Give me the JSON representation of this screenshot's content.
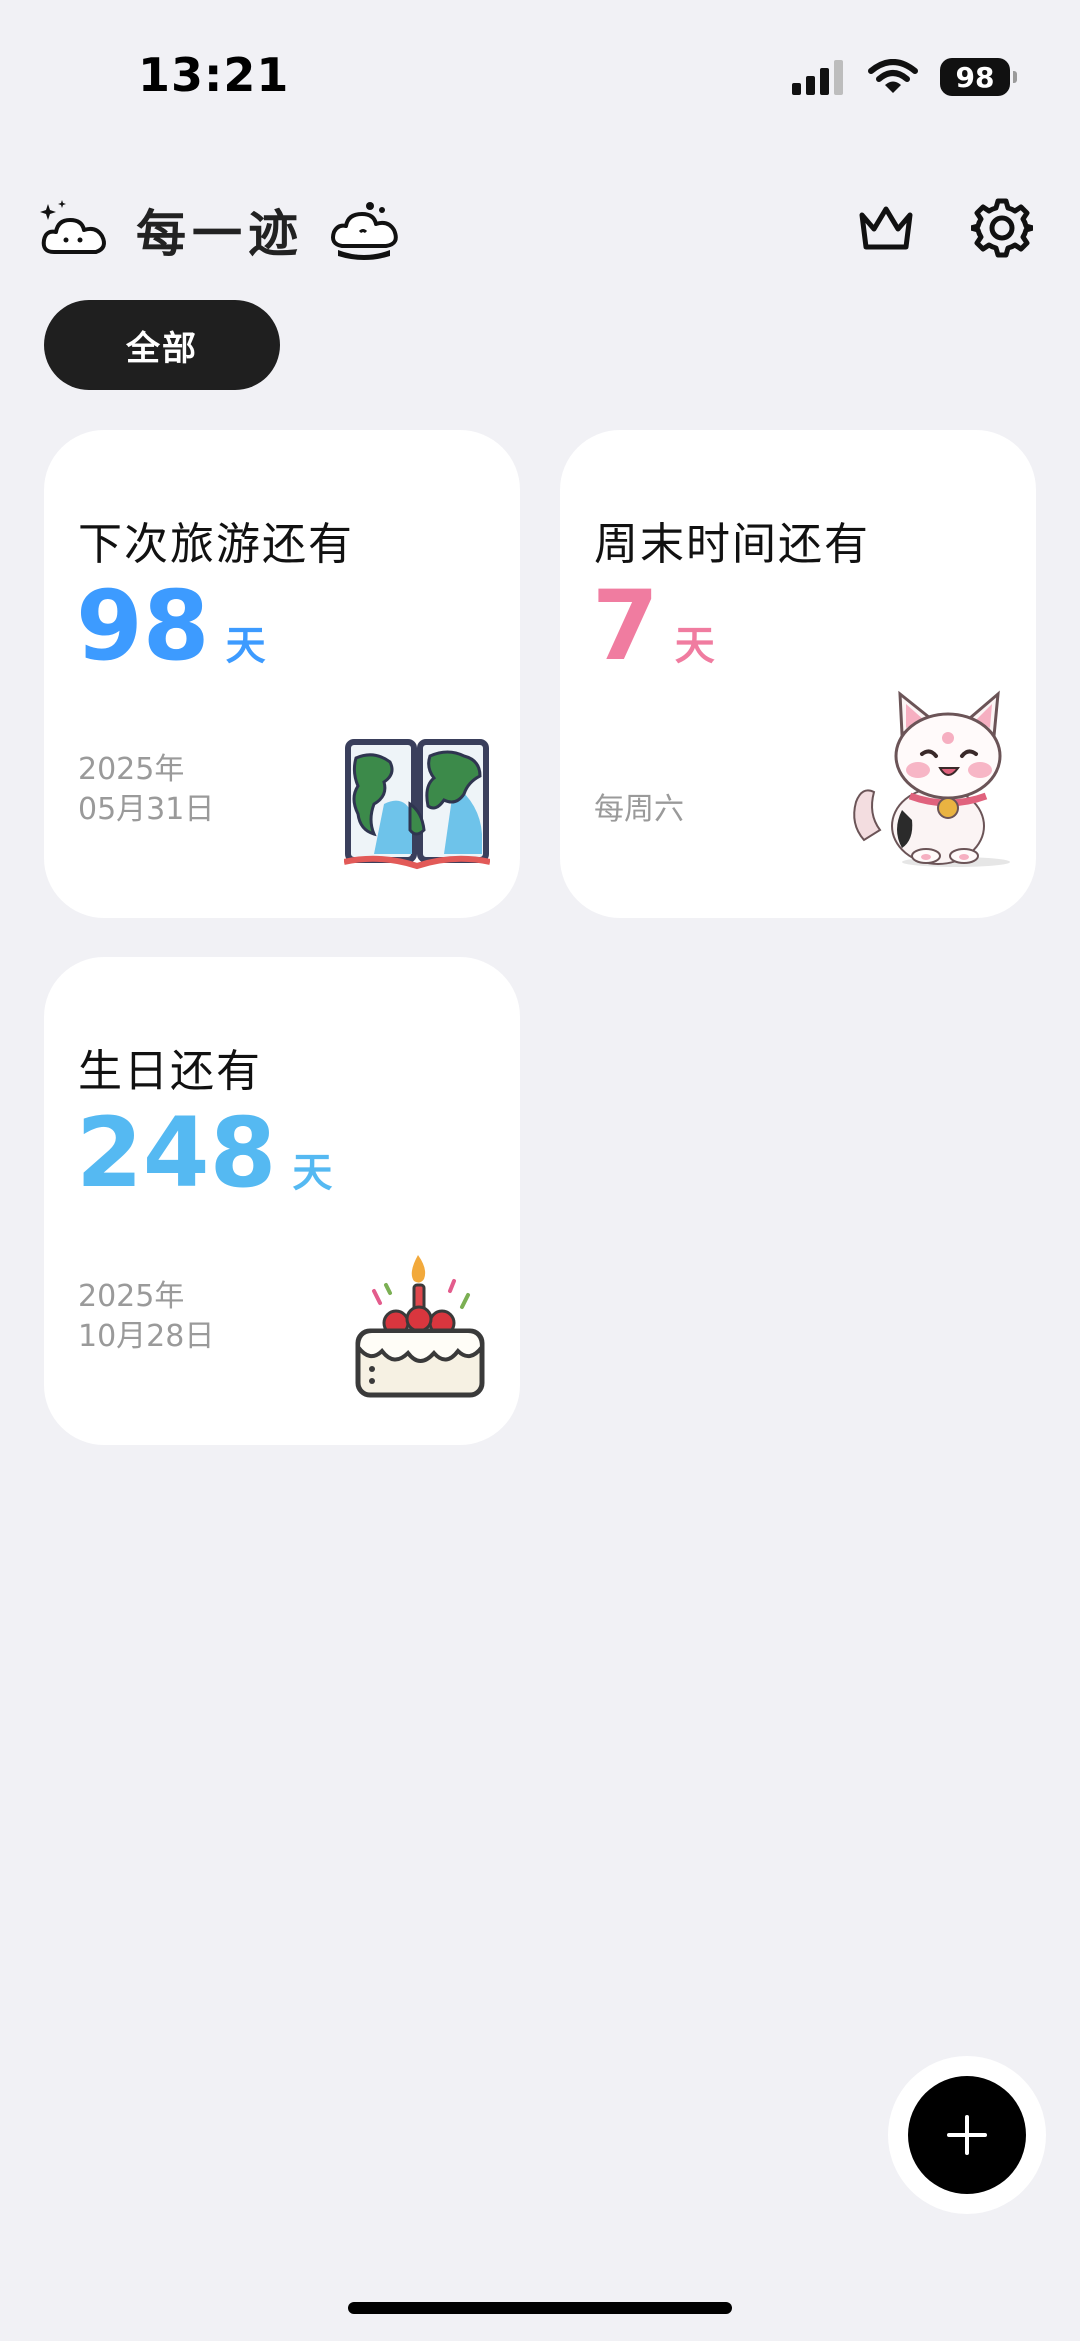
{
  "status_bar": {
    "time": "13:21",
    "battery": "98"
  },
  "header": {
    "title": "每一迹",
    "icons": [
      "cloud-sparkle-icon",
      "cloud-dots-icon",
      "crown-icon",
      "gear-icon"
    ]
  },
  "filter": {
    "active": "全部"
  },
  "cards": [
    {
      "title": "下次旅游还有",
      "count": "98",
      "unit": "天",
      "date_line1": "2025年",
      "date_line2": "05月31日",
      "accent": "#3D9BFF",
      "art": "world-map-book-icon"
    },
    {
      "title": "周末时间还有",
      "count": "7",
      "unit": "天",
      "date_line1": "",
      "date_line2": "每周六",
      "accent": "#F07CA0",
      "art": "kitten-icon"
    },
    {
      "title": "生日还有",
      "count": "248",
      "unit": "天",
      "date_line1": "2025年",
      "date_line2": "10月28日",
      "accent": "#55B9F2",
      "art": "birthday-cake-icon"
    }
  ],
  "fab": {
    "icon": "plus-icon"
  }
}
